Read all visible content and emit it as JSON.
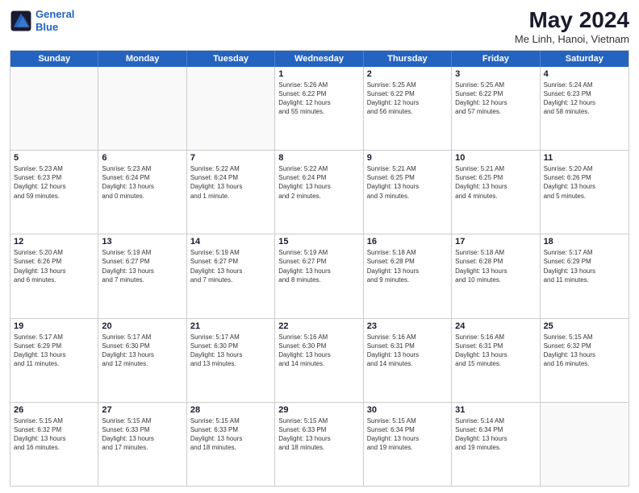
{
  "logo": {
    "line1": "General",
    "line2": "Blue"
  },
  "title": "May 2024",
  "subtitle": "Me Linh, Hanoi, Vietnam",
  "header_days": [
    "Sunday",
    "Monday",
    "Tuesday",
    "Wednesday",
    "Thursday",
    "Friday",
    "Saturday"
  ],
  "weeks": [
    [
      {
        "day": "",
        "text": ""
      },
      {
        "day": "",
        "text": ""
      },
      {
        "day": "",
        "text": ""
      },
      {
        "day": "1",
        "text": "Sunrise: 5:26 AM\nSunset: 6:22 PM\nDaylight: 12 hours\nand 55 minutes."
      },
      {
        "day": "2",
        "text": "Sunrise: 5:25 AM\nSunset: 6:22 PM\nDaylight: 12 hours\nand 56 minutes."
      },
      {
        "day": "3",
        "text": "Sunrise: 5:25 AM\nSunset: 6:22 PM\nDaylight: 12 hours\nand 57 minutes."
      },
      {
        "day": "4",
        "text": "Sunrise: 5:24 AM\nSunset: 6:23 PM\nDaylight: 12 hours\nand 58 minutes."
      }
    ],
    [
      {
        "day": "5",
        "text": "Sunrise: 5:23 AM\nSunset: 6:23 PM\nDaylight: 12 hours\nand 59 minutes."
      },
      {
        "day": "6",
        "text": "Sunrise: 5:23 AM\nSunset: 6:24 PM\nDaylight: 13 hours\nand 0 minutes."
      },
      {
        "day": "7",
        "text": "Sunrise: 5:22 AM\nSunset: 6:24 PM\nDaylight: 13 hours\nand 1 minute."
      },
      {
        "day": "8",
        "text": "Sunrise: 5:22 AM\nSunset: 6:24 PM\nDaylight: 13 hours\nand 2 minutes."
      },
      {
        "day": "9",
        "text": "Sunrise: 5:21 AM\nSunset: 6:25 PM\nDaylight: 13 hours\nand 3 minutes."
      },
      {
        "day": "10",
        "text": "Sunrise: 5:21 AM\nSunset: 6:25 PM\nDaylight: 13 hours\nand 4 minutes."
      },
      {
        "day": "11",
        "text": "Sunrise: 5:20 AM\nSunset: 6:26 PM\nDaylight: 13 hours\nand 5 minutes."
      }
    ],
    [
      {
        "day": "12",
        "text": "Sunrise: 5:20 AM\nSunset: 6:26 PM\nDaylight: 13 hours\nand 6 minutes."
      },
      {
        "day": "13",
        "text": "Sunrise: 5:19 AM\nSunset: 6:27 PM\nDaylight: 13 hours\nand 7 minutes."
      },
      {
        "day": "14",
        "text": "Sunrise: 5:19 AM\nSunset: 6:27 PM\nDaylight: 13 hours\nand 7 minutes."
      },
      {
        "day": "15",
        "text": "Sunrise: 5:19 AM\nSunset: 6:27 PM\nDaylight: 13 hours\nand 8 minutes."
      },
      {
        "day": "16",
        "text": "Sunrise: 5:18 AM\nSunset: 6:28 PM\nDaylight: 13 hours\nand 9 minutes."
      },
      {
        "day": "17",
        "text": "Sunrise: 5:18 AM\nSunset: 6:28 PM\nDaylight: 13 hours\nand 10 minutes."
      },
      {
        "day": "18",
        "text": "Sunrise: 5:17 AM\nSunset: 6:29 PM\nDaylight: 13 hours\nand 11 minutes."
      }
    ],
    [
      {
        "day": "19",
        "text": "Sunrise: 5:17 AM\nSunset: 6:29 PM\nDaylight: 13 hours\nand 11 minutes."
      },
      {
        "day": "20",
        "text": "Sunrise: 5:17 AM\nSunset: 6:30 PM\nDaylight: 13 hours\nand 12 minutes."
      },
      {
        "day": "21",
        "text": "Sunrise: 5:17 AM\nSunset: 6:30 PM\nDaylight: 13 hours\nand 13 minutes."
      },
      {
        "day": "22",
        "text": "Sunrise: 5:16 AM\nSunset: 6:30 PM\nDaylight: 13 hours\nand 14 minutes."
      },
      {
        "day": "23",
        "text": "Sunrise: 5:16 AM\nSunset: 6:31 PM\nDaylight: 13 hours\nand 14 minutes."
      },
      {
        "day": "24",
        "text": "Sunrise: 5:16 AM\nSunset: 6:31 PM\nDaylight: 13 hours\nand 15 minutes."
      },
      {
        "day": "25",
        "text": "Sunrise: 5:15 AM\nSunset: 6:32 PM\nDaylight: 13 hours\nand 16 minutes."
      }
    ],
    [
      {
        "day": "26",
        "text": "Sunrise: 5:15 AM\nSunset: 6:32 PM\nDaylight: 13 hours\nand 16 minutes."
      },
      {
        "day": "27",
        "text": "Sunrise: 5:15 AM\nSunset: 6:33 PM\nDaylight: 13 hours\nand 17 minutes."
      },
      {
        "day": "28",
        "text": "Sunrise: 5:15 AM\nSunset: 6:33 PM\nDaylight: 13 hours\nand 18 minutes."
      },
      {
        "day": "29",
        "text": "Sunrise: 5:15 AM\nSunset: 6:33 PM\nDaylight: 13 hours\nand 18 minutes."
      },
      {
        "day": "30",
        "text": "Sunrise: 5:15 AM\nSunset: 6:34 PM\nDaylight: 13 hours\nand 19 minutes."
      },
      {
        "day": "31",
        "text": "Sunrise: 5:14 AM\nSunset: 6:34 PM\nDaylight: 13 hours\nand 19 minutes."
      },
      {
        "day": "",
        "text": ""
      }
    ]
  ]
}
